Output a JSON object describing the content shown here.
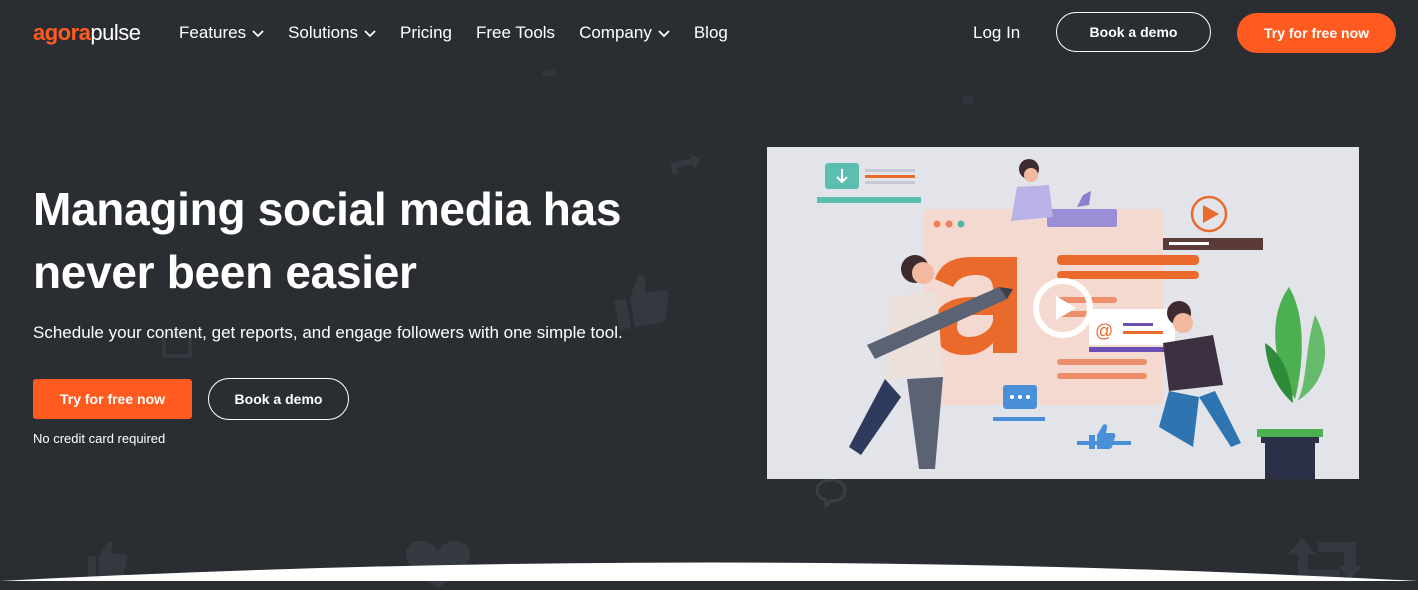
{
  "brand": {
    "logo_part1": "agora",
    "logo_part2": "pulse",
    "accent": "#ff5a1f",
    "background": "#2a2e33"
  },
  "nav": {
    "items": [
      {
        "label": "Features",
        "dropdown": true
      },
      {
        "label": "Solutions",
        "dropdown": true
      },
      {
        "label": "Pricing",
        "dropdown": false
      },
      {
        "label": "Free Tools",
        "dropdown": false
      },
      {
        "label": "Company",
        "dropdown": true
      },
      {
        "label": "Blog",
        "dropdown": false
      }
    ],
    "login": "Log In",
    "book_demo": "Book a demo",
    "try_free": "Try for free now"
  },
  "hero": {
    "title": "Managing social media has never been easier",
    "subtitle": "Schedule your content, get reports, and engage followers with one simple tool.",
    "primary_cta": "Try for free now",
    "secondary_cta": "Book a demo",
    "note": "No credit card required"
  },
  "video": {
    "icon": "play-icon"
  }
}
